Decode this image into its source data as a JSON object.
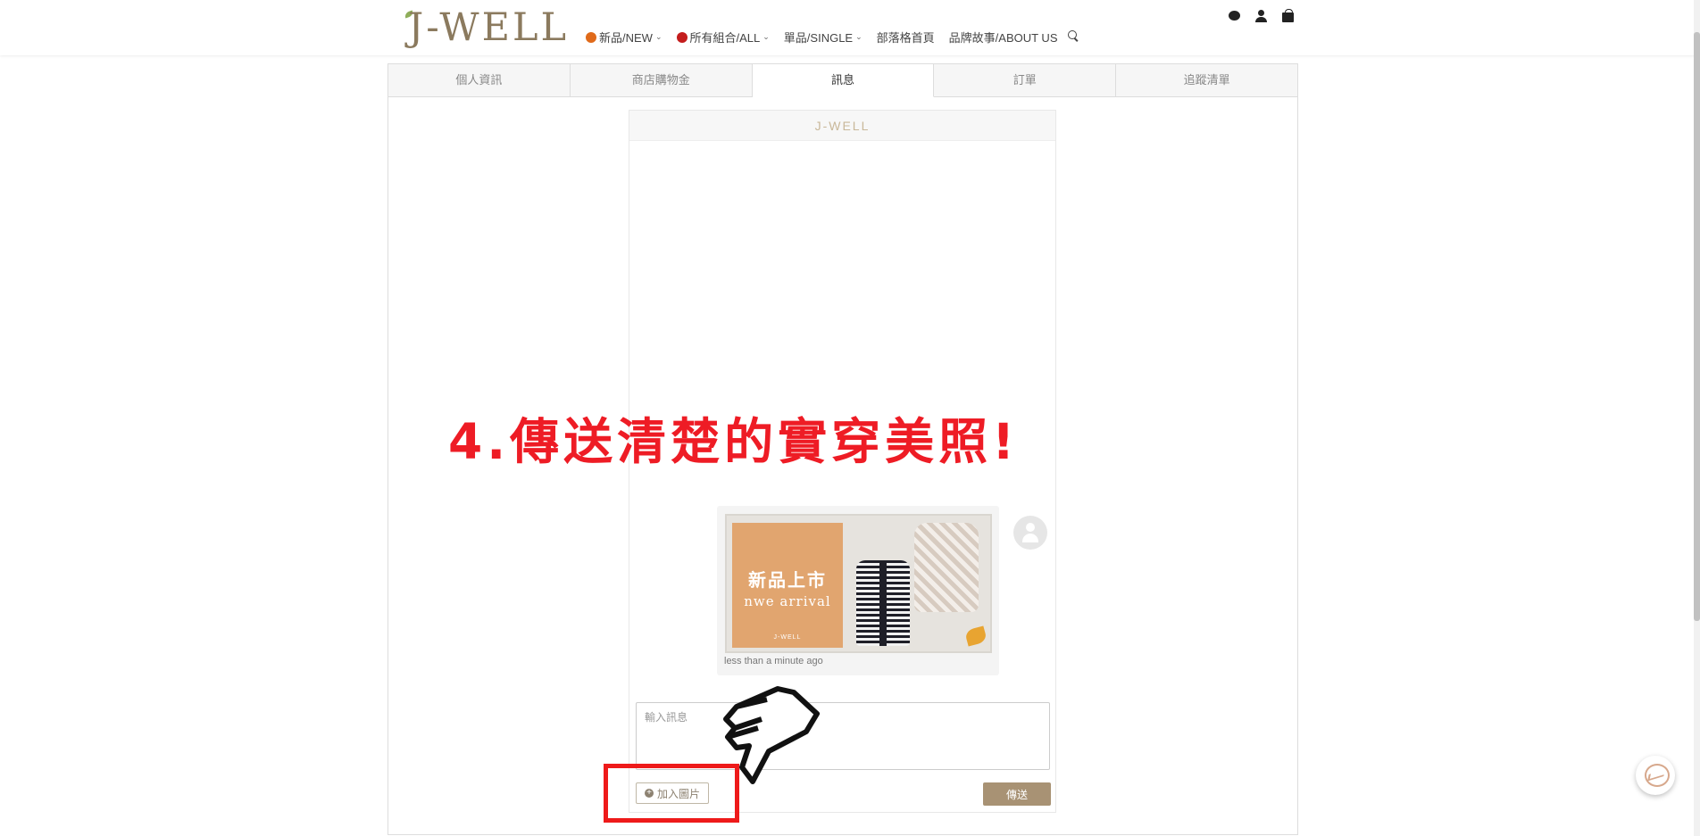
{
  "brand": {
    "logo": "J-WELL"
  },
  "nav": {
    "items": [
      {
        "label": "新品/NEW",
        "icon": "maple-leaf-icon",
        "icon_color": "#e06a1a",
        "has_dropdown": true
      },
      {
        "label": "所有組合/ALL",
        "icon": "flower-icon",
        "icon_color": "#c41d1d",
        "has_dropdown": true
      },
      {
        "label": "單品/SINGLE",
        "has_dropdown": true
      },
      {
        "label": "部落格首頁",
        "has_dropdown": false
      },
      {
        "label": "品牌故事/ABOUT US",
        "has_dropdown": false
      }
    ],
    "search_icon": "search-icon"
  },
  "header_icons": [
    "chat-bubble-icon",
    "user-icon",
    "shopping-bag-icon"
  ],
  "tabs": [
    {
      "label": "個人資訊",
      "active": false
    },
    {
      "label": "商店購物金",
      "active": false
    },
    {
      "label": "訊息",
      "active": true
    },
    {
      "label": "訂單",
      "active": false
    },
    {
      "label": "追蹤清單",
      "active": false
    }
  ],
  "chat": {
    "header": "J-WELL",
    "message": {
      "promo_title": "新品上市",
      "promo_subtitle": "nwe arrival",
      "promo_brand": "J-WELL",
      "time": "less than a minute ago"
    },
    "input_placeholder": "輸入訊息",
    "add_image_label": "加入圖片",
    "send_label": "傳送"
  },
  "instruction": "4.傳送清楚的實穿美照!",
  "colors": {
    "accent": "#a89274",
    "brand": "#8b7a5e",
    "instruction_red": "#ee1c25"
  }
}
